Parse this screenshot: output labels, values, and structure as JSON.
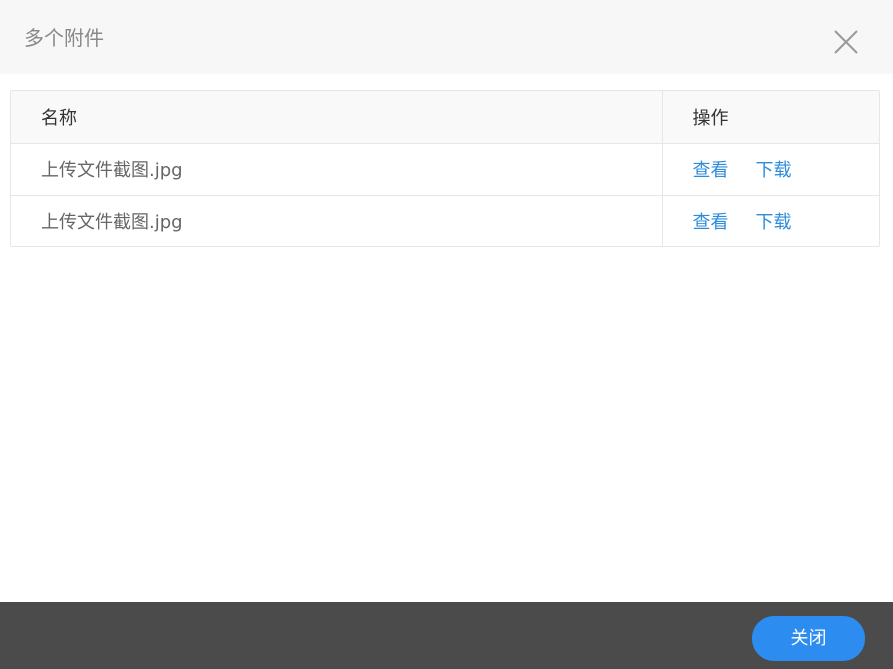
{
  "dialog": {
    "title": "多个附件",
    "close_icon": "close-icon"
  },
  "table": {
    "columns": [
      "名称",
      "操作"
    ],
    "rows": [
      {
        "name": "上传文件截图.jpg",
        "view": "查看",
        "download": "下载"
      },
      {
        "name": "上传文件截图.jpg",
        "view": "查看",
        "download": "下载"
      }
    ]
  },
  "footer": {
    "close_label": "关闭"
  },
  "colors": {
    "accent": "#2d8cf0",
    "link": "#2d8cdb",
    "footer_bg": "#4b4b4b",
    "header_bg": "#f7f7f7"
  }
}
